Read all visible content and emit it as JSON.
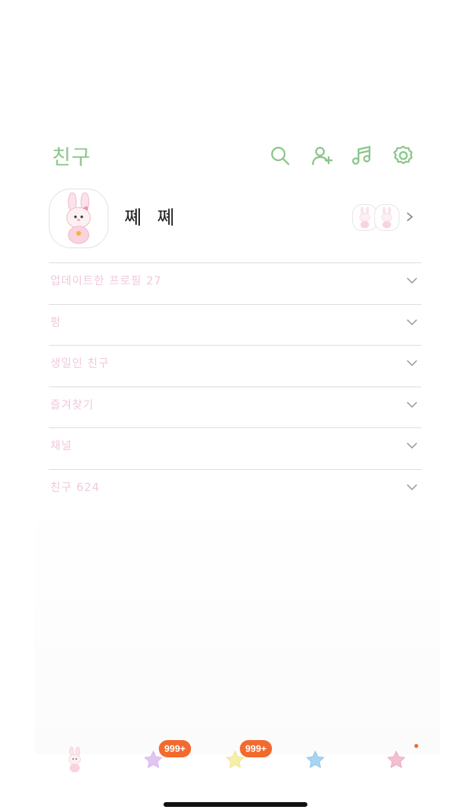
{
  "header": {
    "title": "친구",
    "icons": [
      "search-icon",
      "add-friend-icon",
      "music-icon",
      "settings-icon"
    ],
    "accent_color": "#8cc68a"
  },
  "profile": {
    "name": "쪠 쪠",
    "avatar": "bunny-figure",
    "mini_avatars": [
      "bunny-figure",
      "bunny-figure"
    ]
  },
  "sections": [
    {
      "label": "업데이트한 프로필 27"
    },
    {
      "label": "펑"
    },
    {
      "label": "생일인 친구"
    },
    {
      "label": "즐겨찾기"
    },
    {
      "label": "채널"
    },
    {
      "label": "친구 624"
    }
  ],
  "tabbar": {
    "tabs": [
      {
        "name": "tab-friends",
        "icon": "bunny-figure"
      },
      {
        "name": "tab-chats",
        "icon": "purple-star-icon",
        "color": "#e2c6f2"
      },
      {
        "name": "tab-openchat",
        "icon": "yellow-star-icon",
        "color": "#f6f0a6"
      },
      {
        "name": "tab-shopping",
        "icon": "blue-star-icon",
        "color": "#a8d3f3"
      },
      {
        "name": "tab-more",
        "icon": "pink-star-icon",
        "color": "#f4bfd3"
      }
    ],
    "badges": [
      "999+",
      "999+"
    ],
    "badge_color": "#f26a2e"
  }
}
